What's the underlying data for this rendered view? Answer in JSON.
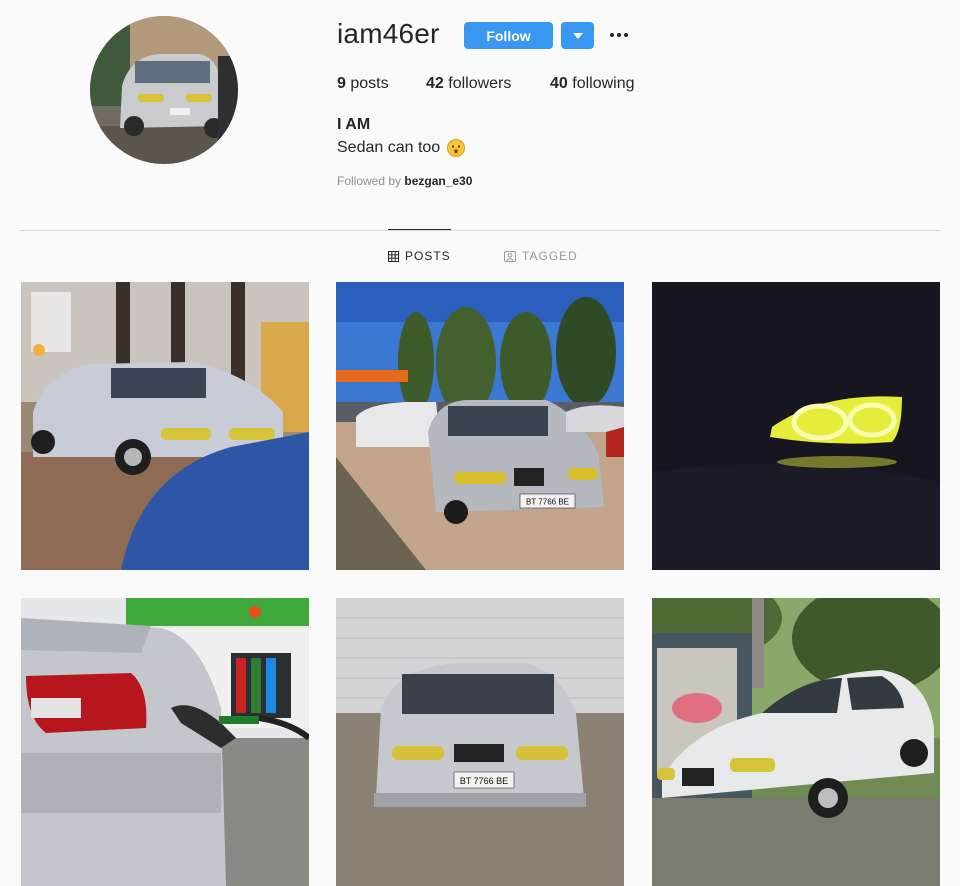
{
  "profile": {
    "username": "iam46er",
    "follow_label": "Follow",
    "full_name": "I AM",
    "bio": "Sedan can too",
    "followed_by_prefix": "Followed by",
    "followed_by_user": "bezgan_e30"
  },
  "stats": {
    "posts": {
      "count": "9",
      "label": "posts"
    },
    "followers": {
      "count": "42",
      "label": "followers"
    },
    "following": {
      "count": "40",
      "label": "following"
    }
  },
  "tabs": {
    "posts": "POSTS",
    "tagged": "TAGGED"
  },
  "posts": [
    {
      "plate": ""
    },
    {
      "plate": "BT 7766 BE"
    },
    {
      "plate": ""
    },
    {
      "plate": ""
    },
    {
      "plate": "BT 7766 BE"
    },
    {
      "plate": ""
    }
  ],
  "colors": {
    "accent": "#3897f0",
    "background": "#fafafa",
    "text": "#262626",
    "muted": "#8e8e8e",
    "headlight": "#e8e84a"
  }
}
